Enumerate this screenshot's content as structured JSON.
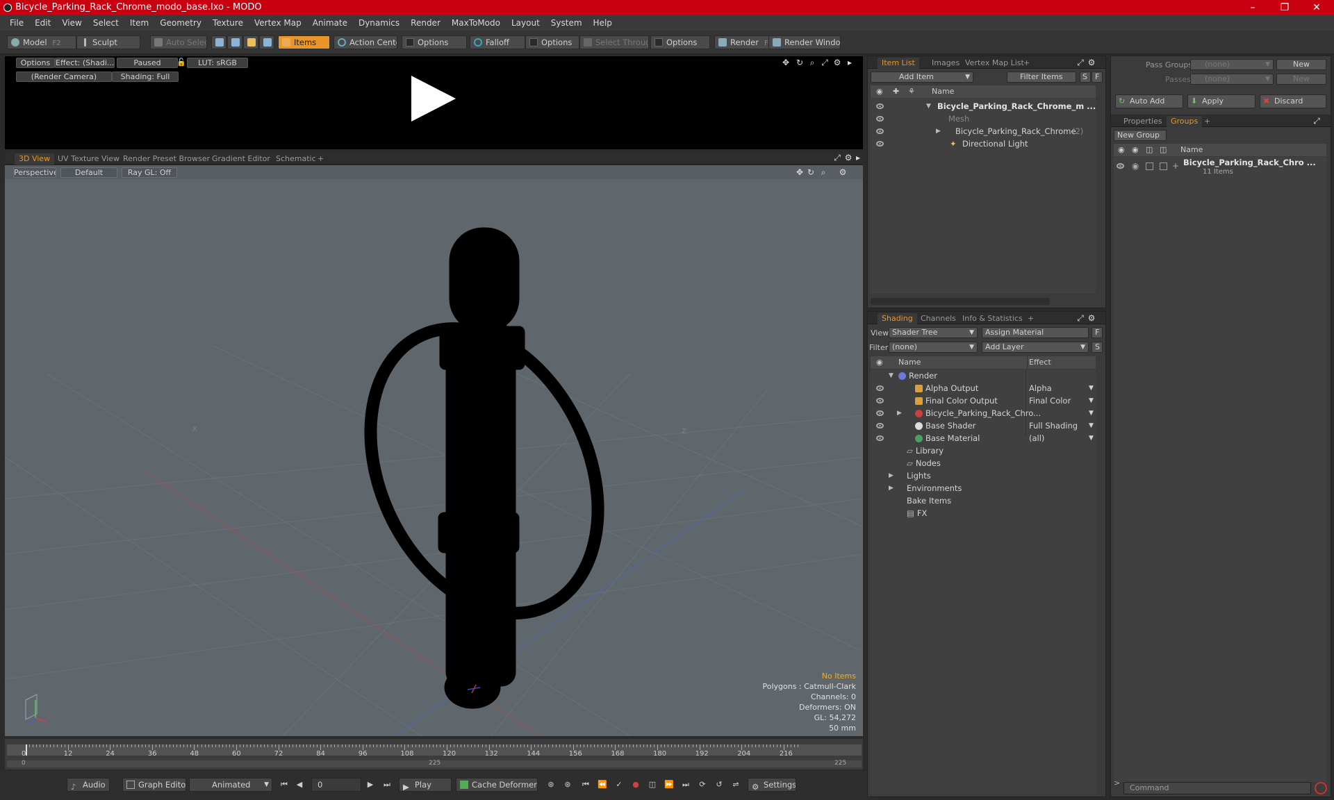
{
  "title": "Bicycle_Parking_Rack_Chrome_modo_base.lxo - MODO",
  "window_controls": [
    "–",
    "❐",
    "✕"
  ],
  "menu": [
    "File",
    "Edit",
    "View",
    "Select",
    "Item",
    "Geometry",
    "Texture",
    "Vertex Map",
    "Animate",
    "Dynamics",
    "Render",
    "MaxToModo",
    "Layout",
    "System",
    "Help"
  ],
  "toolbar": {
    "model": "Model",
    "model_key": "F2",
    "sculpt": "Sculpt",
    "auto_select": "Auto Select",
    "items": "Items",
    "action_center": "Action Center",
    "options1": "Options",
    "falloff": "Falloff",
    "options2": "Options",
    "select_through": "Select Through",
    "options3": "Options",
    "render": "Render",
    "render_key": "F9",
    "render_window": "Render Window"
  },
  "preview": {
    "options": "Options",
    "effect": "Effect: (Shadi...",
    "paused": "Paused",
    "lut": "LUT: sRGB",
    "camera": "(Render Camera)",
    "shading": "Shading: Full"
  },
  "view_tabs": [
    "3D View",
    "UV Texture View",
    "Render Preset Browser",
    "Gradient Editor",
    "Schematic",
    "+"
  ],
  "viewport": {
    "perspective": "Perspective",
    "default": "Default",
    "raygl": "Ray GL: Off",
    "axis_x": "X",
    "axis_z": "Z"
  },
  "stats": {
    "no_items": "No Items",
    "polygons": "Polygons : Catmull-Clark",
    "channels": "Channels: 0",
    "deformers": "Deformers: ON",
    "gl": "GL: 54,272",
    "unit": "50 mm"
  },
  "timeline": {
    "ticks": [
      "0",
      "12",
      "24",
      "36",
      "48",
      "60",
      "72",
      "84",
      "96",
      "108",
      "120",
      "132",
      "144",
      "156",
      "168",
      "180",
      "192",
      "204",
      "216"
    ],
    "range_start": "0",
    "range_mid": "225",
    "range_end": "225"
  },
  "transport": {
    "audio": "Audio",
    "graph_editor": "Graph Editor",
    "animated": "Animated",
    "frame": "0",
    "play": "Play",
    "cache": "Cache Deformers",
    "settings": "Settings"
  },
  "item_list": {
    "tabs": [
      "Item List",
      "Images",
      "Vertex Map List",
      "+"
    ],
    "add_item": "Add Item",
    "filter": "Filter Items",
    "s": "S",
    "f": "F",
    "col_name": "Name",
    "rows": [
      {
        "label": "Bicycle_Parking_Rack_Chrome_m ...",
        "suffix": ""
      },
      {
        "label": "Mesh",
        "suffix": ""
      },
      {
        "label": "Bicycle_Parking_Rack_Chrome",
        "suffix": "(2)"
      },
      {
        "label": "Directional Light",
        "suffix": ""
      }
    ]
  },
  "shading": {
    "tabs": [
      "Shading",
      "Channels",
      "Info & Statistics",
      "+"
    ],
    "view_label": "View",
    "view_value": "Shader Tree",
    "assign": "Assign Material",
    "filter_label": "Filter",
    "filter_value": "(none)",
    "add_layer": "Add Layer",
    "f": "F",
    "s": "S",
    "col_name": "Name",
    "col_effect": "Effect",
    "rows": [
      {
        "label": "Render",
        "effect": ""
      },
      {
        "label": "Alpha Output",
        "effect": "Alpha"
      },
      {
        "label": "Final Color Output",
        "effect": "Final Color"
      },
      {
        "label": "Bicycle_Parking_Rack_Chro...",
        "effect": ""
      },
      {
        "label": "Base Shader",
        "effect": "Full Shading"
      },
      {
        "label": "Base Material",
        "effect": "(all)"
      },
      {
        "label": "Library",
        "effect": ""
      },
      {
        "label": "Nodes",
        "effect": ""
      },
      {
        "label": "Lights",
        "effect": ""
      },
      {
        "label": "Environments",
        "effect": ""
      },
      {
        "label": "Bake Items",
        "effect": ""
      },
      {
        "label": "FX",
        "effect": ""
      }
    ]
  },
  "groups": {
    "pass_groups": "Pass Groups",
    "passes": "Passes",
    "none1": "(none)",
    "none2": "(none)",
    "new1": "New",
    "new2": "New",
    "auto_add": "Auto Add",
    "apply": "Apply",
    "discard": "Discard",
    "tabs": [
      "Properties",
      "Groups",
      "+"
    ],
    "new_group": "New Group",
    "col_name": "Name",
    "group_name": "Bicycle_Parking_Rack_Chro ...",
    "group_count": "11 Items"
  },
  "command": {
    "placeholder": "Command",
    "prompt": ">"
  }
}
